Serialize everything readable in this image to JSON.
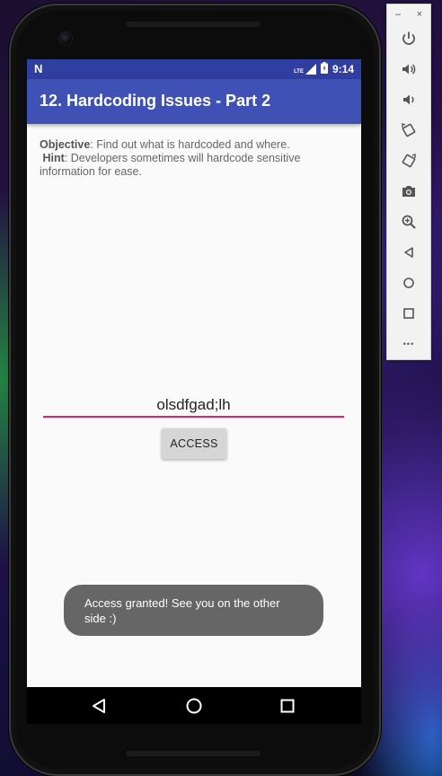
{
  "status_bar": {
    "network_icon": "android-n-logo",
    "signal_label": "LTE",
    "time": "9:14"
  },
  "app_bar": {
    "title": "12. Hardcoding Issues - Part 2"
  },
  "content": {
    "objective_label": "Objective",
    "objective_text": ": Find out what is hardcoded and where.",
    "hint_label": "Hint",
    "hint_text": ": Developers sometimes will hardcode sensitive information for ease."
  },
  "input": {
    "value": "olsdfgad;lh"
  },
  "access_button": {
    "label": "ACCESS"
  },
  "toast": {
    "message": "Access granted! See you on the other side :)"
  },
  "nav_bar": {
    "back": "back-icon",
    "home": "home-icon",
    "recents": "recents-icon"
  },
  "emulator_toolbar": {
    "minimize": "–",
    "close": "×",
    "more": "•••",
    "buttons": [
      "power-icon",
      "volume-up-icon",
      "volume-down-icon",
      "rotate-left-icon",
      "rotate-right-icon",
      "camera-icon",
      "zoom-icon",
      "back-icon",
      "home-icon",
      "overview-icon",
      "more-icon"
    ]
  },
  "colors": {
    "primary": "#3f51b5",
    "primary_dark": "#303f9f",
    "accent": "#e91e63",
    "toast": "#666666"
  }
}
